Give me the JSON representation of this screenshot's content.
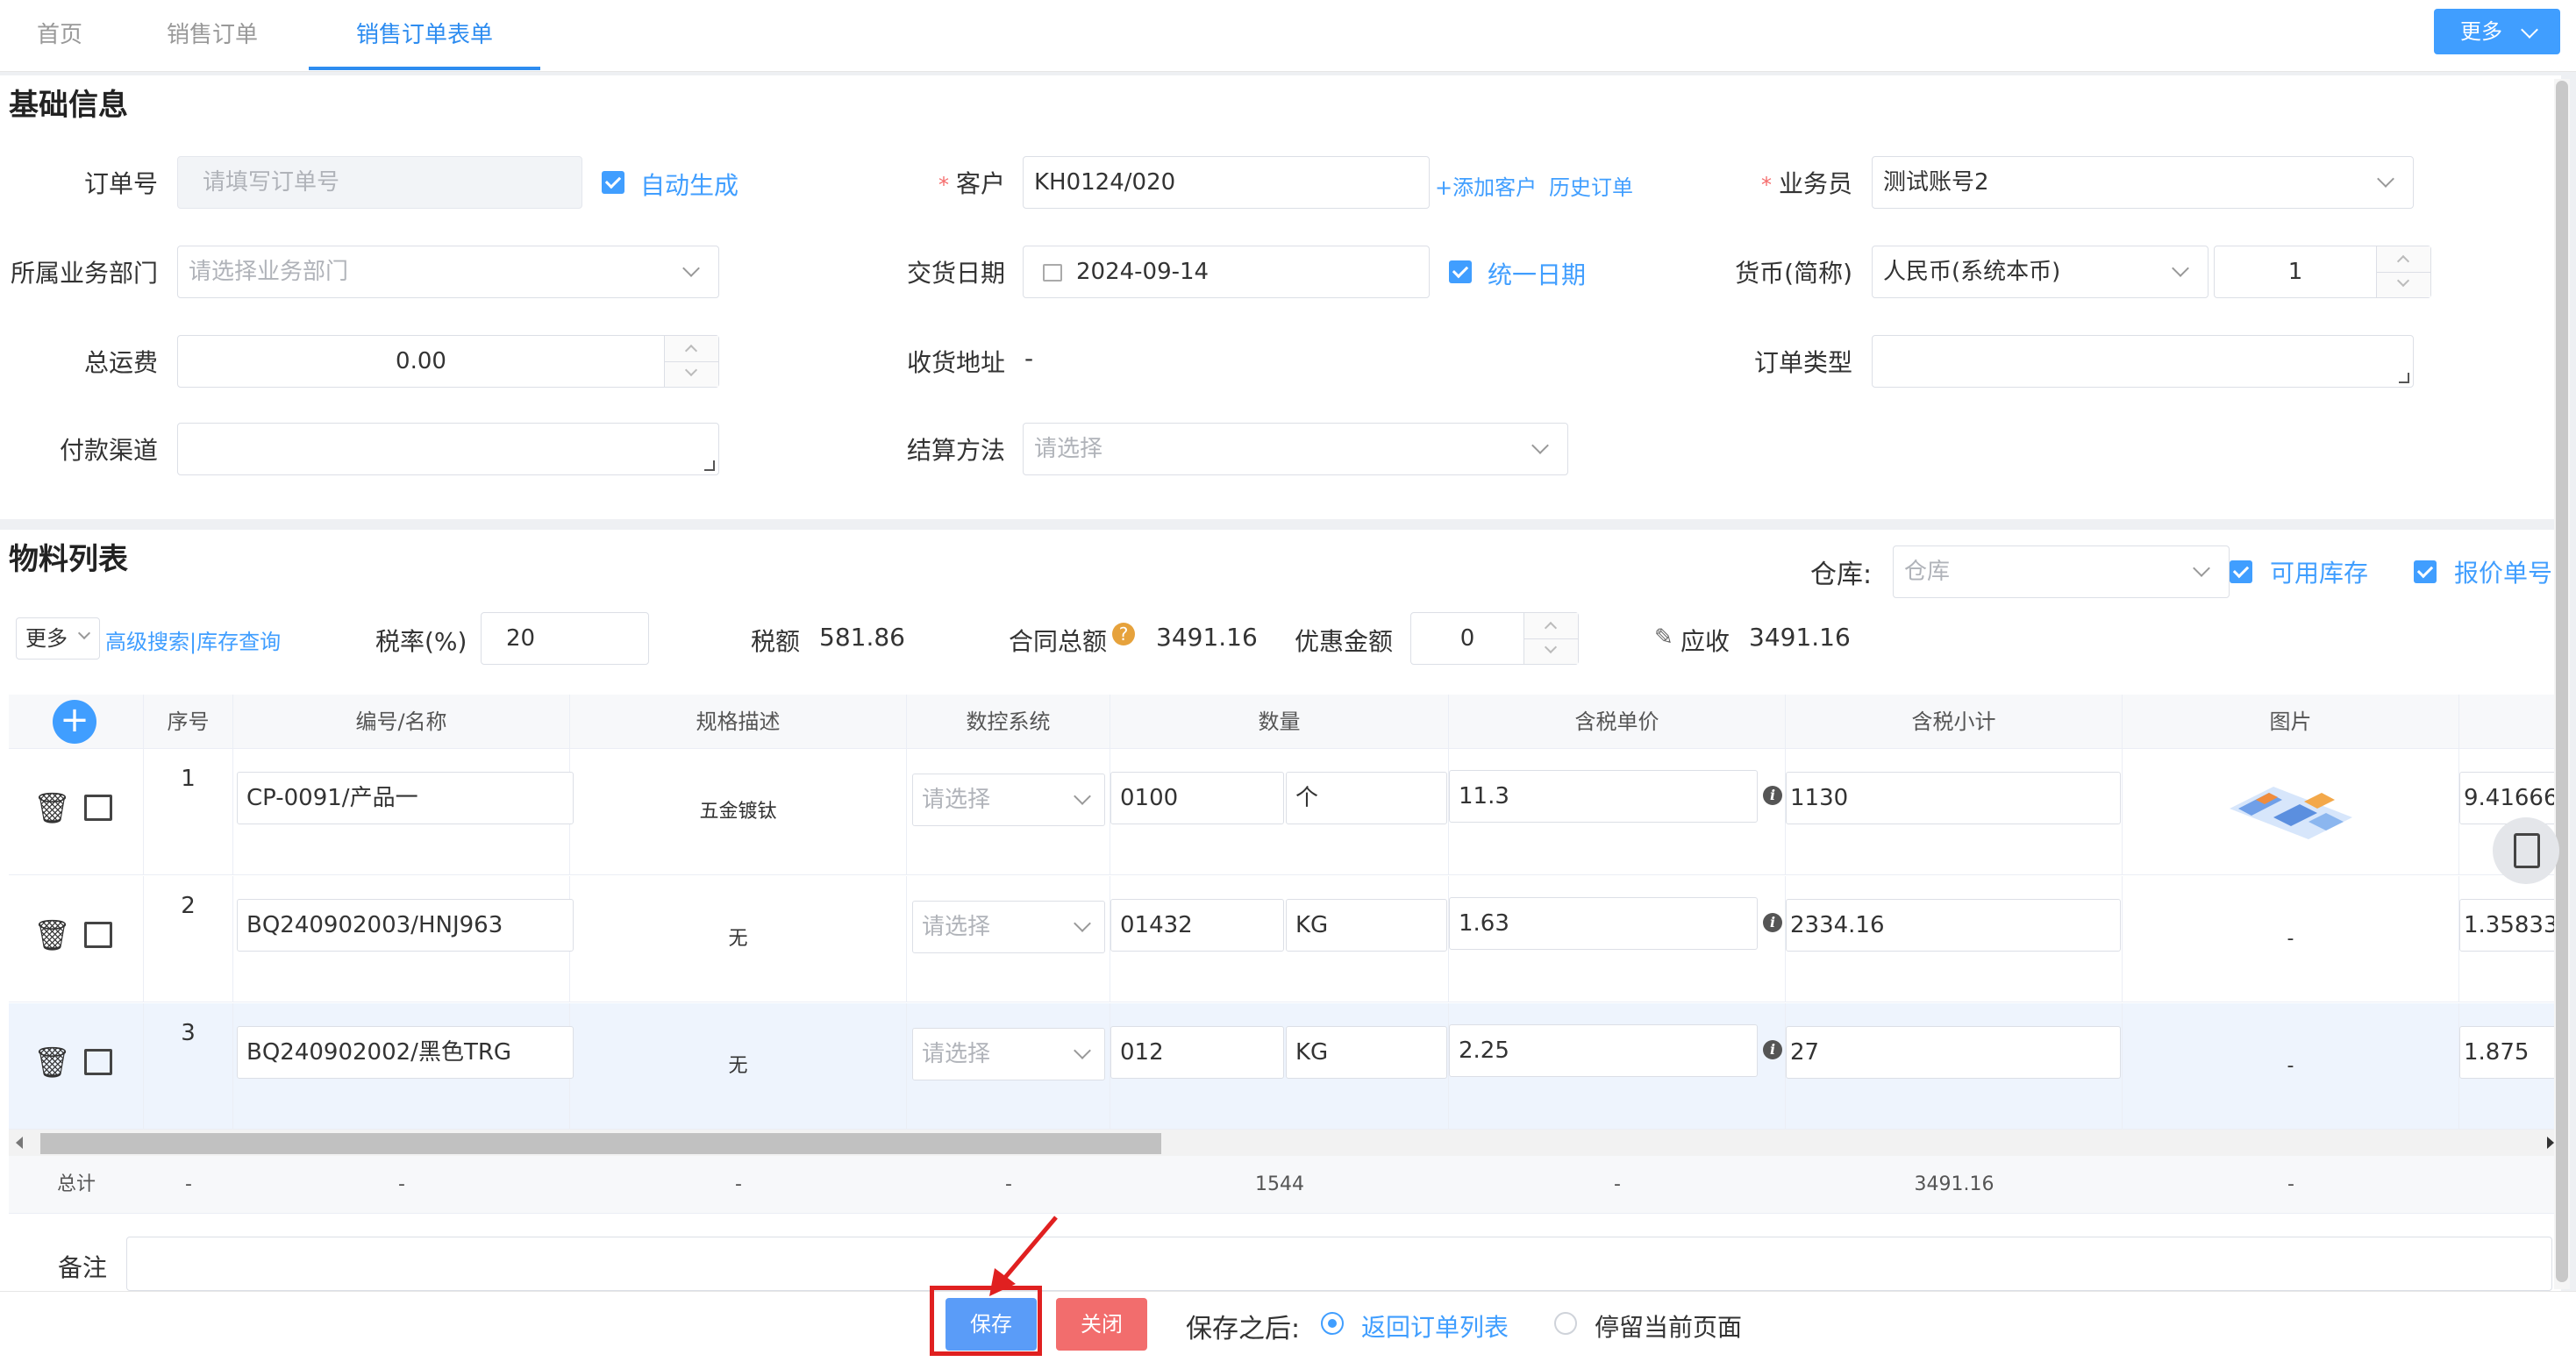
{
  "tabs": [
    {
      "label": "首页"
    },
    {
      "label": "销售订单"
    },
    {
      "label": "销售订单表单"
    }
  ],
  "more_button": "更多",
  "basic": {
    "title": "基础信息",
    "order_no_label": "订单号",
    "order_no_placeholder": "请填写订单号",
    "auto_generate": "自动生成",
    "customer_label": "客户",
    "customer_value": "KH0124/020",
    "add_customer": "+添加客户",
    "history_orders": "历史订单",
    "salesman_label": "业务员",
    "salesman_value": "测试账号2",
    "dept_label": "所属业务部门",
    "dept_placeholder": "请选择业务部门",
    "delivery_label": "交货日期",
    "delivery_value": "2024-09-14",
    "unify_date": "统一日期",
    "currency_label": "货币(简称)",
    "currency_value": "人民币(系统本币)",
    "currency_rate": "1",
    "freight_label": "总运费",
    "freight_value": "0.00",
    "address_label": "收货地址",
    "address_value": "-",
    "order_type_label": "订单类型",
    "payment_label": "付款渠道",
    "settle_label": "结算方法",
    "settle_placeholder": "请选择"
  },
  "materials": {
    "title": "物料列表",
    "warehouse_label": "仓库:",
    "warehouse_placeholder": "仓库",
    "available_stock": "可用库存",
    "quote_no": "报价单号",
    "more_select": "更多",
    "adv_search": "高级搜索|库存查询",
    "tax_rate_label": "税率(%)",
    "tax_rate_value": "20",
    "tax_amount_label": "税额",
    "tax_amount_value": "581.86",
    "contract_total_label": "合同总额",
    "contract_total_value": "3491.16",
    "discount_label": "优惠金额",
    "discount_value": "0",
    "receivable_label": "应收",
    "receivable_value": "3491.16"
  },
  "table": {
    "headers": [
      "序号",
      "编号/名称",
      "规格描述",
      "数控系统",
      "数量",
      "含税单价",
      "含税小计",
      "图片"
    ],
    "rows": [
      {
        "seq": "1",
        "code": "CP-0091/产品一",
        "spec": "五金镀钛",
        "cnc": "请选择",
        "qty": "0100",
        "unit": "个",
        "price": "11.3",
        "subtotal": "1130",
        "image": "",
        "extra": "9.41666"
      },
      {
        "seq": "2",
        "code": "BQ240902003/HNJ963",
        "spec": "无",
        "cnc": "请选择",
        "qty": "01432",
        "unit": "KG",
        "price": "1.63",
        "subtotal": "2334.16",
        "image": "-",
        "extra": "1.35833"
      },
      {
        "seq": "3",
        "code": "BQ240902002/黑色TRG",
        "spec": "无",
        "cnc": "请选择",
        "qty": "012",
        "unit": "KG",
        "price": "2.25",
        "subtotal": "27",
        "image": "-",
        "extra": "1.875"
      }
    ],
    "totals": {
      "label": "总计",
      "dash": "-",
      "qty": "1544",
      "subtotal": "3491.16"
    }
  },
  "remark_label": "备注",
  "footer": {
    "save": "保存",
    "close": "关闭",
    "after_save_label": "保存之后:",
    "return_list": "返回订单列表",
    "stay_page": "停留当前页面"
  },
  "colors": {
    "primary": "#409eff",
    "danger": "#f26d6d",
    "highlight": "#e02020"
  }
}
